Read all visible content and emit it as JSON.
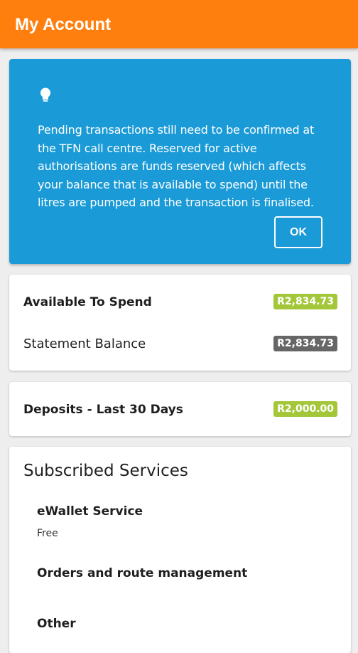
{
  "appbar": {
    "title": "My Account",
    "color": "#ff7f0e"
  },
  "info_card": {
    "icon": "lightbulb-icon",
    "text": "Pending transactions still need to be confirmed at the TFN call centre. Reserved for active authorisations are funds reserved (which affects your balance that is available to spend) until the litres are pumped and the transaction is finalised.",
    "button_label": "OK",
    "color": "#1a9ad6"
  },
  "balances": {
    "available_label": "Available To Spend",
    "available_value": "R2,834.73",
    "statement_label": "Statement Balance",
    "statement_value": "R2,834.73",
    "positive_color": "#a4c639",
    "neutral_color": "#666666"
  },
  "deposits": {
    "label": "Deposits - Last 30 Days",
    "value": "R2,000.00"
  },
  "services": {
    "title": "Subscribed Services",
    "items": [
      {
        "name": "eWallet Service",
        "detail": "Free"
      },
      {
        "name": "Orders and route management"
      },
      {
        "name": "Other"
      }
    ]
  }
}
